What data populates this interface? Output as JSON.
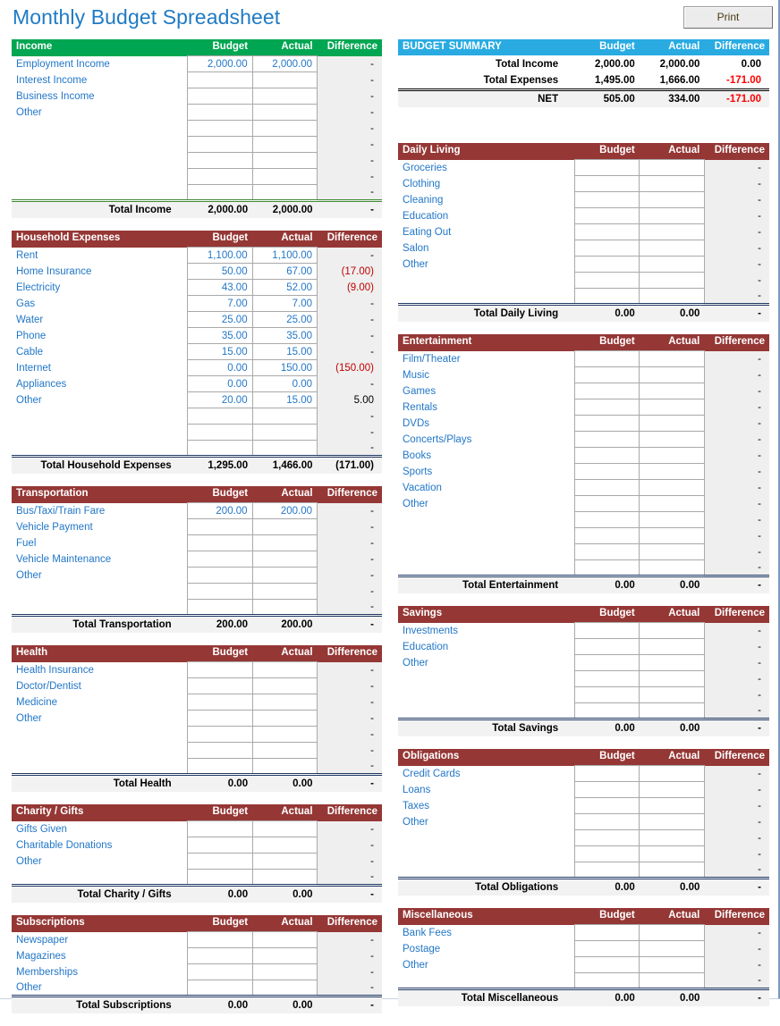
{
  "page": {
    "title": "Monthly Budget Spreadsheet",
    "print_label": "Print"
  },
  "columns": {
    "name_header_default": "",
    "budget": "Budget",
    "actual": "Actual",
    "difference": "Difference"
  },
  "colors": {
    "income_header": "#00a651",
    "expense_header": "#953735",
    "summary_header": "#29abe2",
    "label_blue": "#2277c8",
    "negative_red": "#c00000",
    "title_blue": "#1f7ac4"
  },
  "summary": {
    "header": "BUDGET SUMMARY",
    "budget": "Budget",
    "actual": "Actual",
    "difference": "Difference",
    "rows": [
      {
        "label": "Total Income",
        "budget": "2,000.00",
        "actual": "2,000.00",
        "difference": "0.00",
        "negative": false
      },
      {
        "label": "Total Expenses",
        "budget": "1,495.00",
        "actual": "1,666.00",
        "difference": "-171.00",
        "negative": true
      },
      {
        "label": "NET",
        "budget": "505.00",
        "actual": "334.00",
        "difference": "-171.00",
        "negative": true
      }
    ]
  },
  "sections": {
    "income": {
      "header": "Income",
      "total_label": "Total Income",
      "total_budget": "2,000.00",
      "total_actual": "2,000.00",
      "total_difference": "-",
      "total_negative": false,
      "rows": [
        {
          "label": "Employment Income",
          "budget": "2,000.00",
          "actual": "2,000.00",
          "difference": "-",
          "negative": false
        },
        {
          "label": "Interest Income",
          "budget": "",
          "actual": "",
          "difference": "-",
          "negative": false
        },
        {
          "label": "Business Income",
          "budget": "",
          "actual": "",
          "difference": "-",
          "negative": false
        },
        {
          "label": "Other",
          "budget": "",
          "actual": "",
          "difference": "-",
          "negative": false
        },
        {
          "label": "",
          "budget": "",
          "actual": "",
          "difference": "-",
          "negative": false
        },
        {
          "label": "",
          "budget": "",
          "actual": "",
          "difference": "-",
          "negative": false
        },
        {
          "label": "",
          "budget": "",
          "actual": "",
          "difference": "-",
          "negative": false
        },
        {
          "label": "",
          "budget": "",
          "actual": "",
          "difference": "-",
          "negative": false
        },
        {
          "label": "",
          "budget": "",
          "actual": "",
          "difference": "-",
          "negative": false
        }
      ]
    },
    "household": {
      "header": "Household Expenses",
      "total_label": "Total Household Expenses",
      "total_budget": "1,295.00",
      "total_actual": "1,466.00",
      "total_difference": "(171.00)",
      "total_negative": false,
      "rows": [
        {
          "label": "Rent",
          "budget": "1,100.00",
          "actual": "1,100.00",
          "difference": "-",
          "negative": false
        },
        {
          "label": "Home Insurance",
          "budget": "50.00",
          "actual": "67.00",
          "difference": "(17.00)",
          "negative": true
        },
        {
          "label": "Electricity",
          "budget": "43.00",
          "actual": "52.00",
          "difference": "(9.00)",
          "negative": true
        },
        {
          "label": "Gas",
          "budget": "7.00",
          "actual": "7.00",
          "difference": "-",
          "negative": false
        },
        {
          "label": "Water",
          "budget": "25.00",
          "actual": "25.00",
          "difference": "-",
          "negative": false
        },
        {
          "label": "Phone",
          "budget": "35.00",
          "actual": "35.00",
          "difference": "-",
          "negative": false
        },
        {
          "label": "Cable",
          "budget": "15.00",
          "actual": "15.00",
          "difference": "-",
          "negative": false
        },
        {
          "label": "Internet",
          "budget": "0.00",
          "actual": "150.00",
          "difference": "(150.00)",
          "negative": true
        },
        {
          "label": "Appliances",
          "budget": "0.00",
          "actual": "0.00",
          "difference": "-",
          "negative": false
        },
        {
          "label": "Other",
          "budget": "20.00",
          "actual": "15.00",
          "difference": "5.00",
          "negative": false
        },
        {
          "label": "",
          "budget": "",
          "actual": "",
          "difference": "-",
          "negative": false
        },
        {
          "label": "",
          "budget": "",
          "actual": "",
          "difference": "-",
          "negative": false
        },
        {
          "label": "",
          "budget": "",
          "actual": "",
          "difference": "-",
          "negative": false
        }
      ]
    },
    "transportation": {
      "header": "Transportation",
      "total_label": "Total Transportation",
      "total_budget": "200.00",
      "total_actual": "200.00",
      "total_difference": "-",
      "total_negative": false,
      "rows": [
        {
          "label": "Bus/Taxi/Train Fare",
          "budget": "200.00",
          "actual": "200.00",
          "difference": "-",
          "negative": false
        },
        {
          "label": "Vehicle Payment",
          "budget": "",
          "actual": "",
          "difference": "-",
          "negative": false
        },
        {
          "label": "Fuel",
          "budget": "",
          "actual": "",
          "difference": "-",
          "negative": false
        },
        {
          "label": "Vehicle Maintenance",
          "budget": "",
          "actual": "",
          "difference": "-",
          "negative": false
        },
        {
          "label": "Other",
          "budget": "",
          "actual": "",
          "difference": "-",
          "negative": false
        },
        {
          "label": "",
          "budget": "",
          "actual": "",
          "difference": "-",
          "negative": false
        },
        {
          "label": "",
          "budget": "",
          "actual": "",
          "difference": "-",
          "negative": false
        }
      ]
    },
    "health": {
      "header": "Health",
      "total_label": "Total Health",
      "total_budget": "0.00",
      "total_actual": "0.00",
      "total_difference": "-",
      "total_negative": false,
      "rows": [
        {
          "label": "Health Insurance",
          "budget": "",
          "actual": "",
          "difference": "-",
          "negative": false
        },
        {
          "label": "Doctor/Dentist",
          "budget": "",
          "actual": "",
          "difference": "-",
          "negative": false
        },
        {
          "label": "Medicine",
          "budget": "",
          "actual": "",
          "difference": "-",
          "negative": false
        },
        {
          "label": "Other",
          "budget": "",
          "actual": "",
          "difference": "-",
          "negative": false
        },
        {
          "label": "",
          "budget": "",
          "actual": "",
          "difference": "-",
          "negative": false
        },
        {
          "label": "",
          "budget": "",
          "actual": "",
          "difference": "-",
          "negative": false
        },
        {
          "label": "",
          "budget": "",
          "actual": "",
          "difference": "-",
          "negative": false
        }
      ]
    },
    "charity": {
      "header": "Charity / Gifts",
      "total_label": "Total Charity / Gifts",
      "total_budget": "0.00",
      "total_actual": "0.00",
      "total_difference": "-",
      "total_negative": false,
      "rows": [
        {
          "label": "Gifts Given",
          "budget": "",
          "actual": "",
          "difference": "-",
          "negative": false
        },
        {
          "label": "Charitable Donations",
          "budget": "",
          "actual": "",
          "difference": "-",
          "negative": false
        },
        {
          "label": "Other",
          "budget": "",
          "actual": "",
          "difference": "-",
          "negative": false
        },
        {
          "label": "",
          "budget": "",
          "actual": "",
          "difference": "-",
          "negative": false
        }
      ]
    },
    "subscriptions": {
      "header": "Subscriptions",
      "total_label": "Total Subscriptions",
      "total_budget": "0.00",
      "total_actual": "0.00",
      "total_difference": "-",
      "total_negative": false,
      "rows": [
        {
          "label": "Newspaper",
          "budget": "",
          "actual": "",
          "difference": "-",
          "negative": false
        },
        {
          "label": "Magazines",
          "budget": "",
          "actual": "",
          "difference": "-",
          "negative": false
        },
        {
          "label": "Memberships",
          "budget": "",
          "actual": "",
          "difference": "-",
          "negative": false
        },
        {
          "label": "Other",
          "budget": "",
          "actual": "",
          "difference": "-",
          "negative": false
        }
      ]
    },
    "daily_living": {
      "header": "Daily Living",
      "total_label": "Total Daily Living",
      "total_budget": "0.00",
      "total_actual": "0.00",
      "total_difference": "-",
      "total_negative": false,
      "rows": [
        {
          "label": "Groceries",
          "budget": "",
          "actual": "",
          "difference": "-",
          "negative": false
        },
        {
          "label": "Clothing",
          "budget": "",
          "actual": "",
          "difference": "-",
          "negative": false
        },
        {
          "label": "Cleaning",
          "budget": "",
          "actual": "",
          "difference": "-",
          "negative": false
        },
        {
          "label": "Education",
          "budget": "",
          "actual": "",
          "difference": "-",
          "negative": false
        },
        {
          "label": "Eating Out",
          "budget": "",
          "actual": "",
          "difference": "-",
          "negative": false
        },
        {
          "label": "Salon",
          "budget": "",
          "actual": "",
          "difference": "-",
          "negative": false
        },
        {
          "label": "Other",
          "budget": "",
          "actual": "",
          "difference": "-",
          "negative": false
        },
        {
          "label": "",
          "budget": "",
          "actual": "",
          "difference": "-",
          "negative": false
        },
        {
          "label": "",
          "budget": "",
          "actual": "",
          "difference": "-",
          "negative": false
        }
      ]
    },
    "entertainment": {
      "header": "Entertainment",
      "total_label": "Total Entertainment",
      "total_budget": "0.00",
      "total_actual": "0.00",
      "total_difference": "-",
      "total_negative": false,
      "rows": [
        {
          "label": "Film/Theater",
          "budget": "",
          "actual": "",
          "difference": "-",
          "negative": false
        },
        {
          "label": "Music",
          "budget": "",
          "actual": "",
          "difference": "-",
          "negative": false
        },
        {
          "label": "Games",
          "budget": "",
          "actual": "",
          "difference": "-",
          "negative": false
        },
        {
          "label": "Rentals",
          "budget": "",
          "actual": "",
          "difference": "-",
          "negative": false
        },
        {
          "label": "DVDs",
          "budget": "",
          "actual": "",
          "difference": "-",
          "negative": false
        },
        {
          "label": "Concerts/Plays",
          "budget": "",
          "actual": "",
          "difference": "-",
          "negative": false
        },
        {
          "label": "Books",
          "budget": "",
          "actual": "",
          "difference": "-",
          "negative": false
        },
        {
          "label": "Sports",
          "budget": "",
          "actual": "",
          "difference": "-",
          "negative": false
        },
        {
          "label": "Vacation",
          "budget": "",
          "actual": "",
          "difference": "-",
          "negative": false
        },
        {
          "label": "Other",
          "budget": "",
          "actual": "",
          "difference": "-",
          "negative": false
        },
        {
          "label": "",
          "budget": "",
          "actual": "",
          "difference": "-",
          "negative": false
        },
        {
          "label": "",
          "budget": "",
          "actual": "",
          "difference": "-",
          "negative": false
        },
        {
          "label": "",
          "budget": "",
          "actual": "",
          "difference": "-",
          "negative": false
        },
        {
          "label": "",
          "budget": "",
          "actual": "",
          "difference": "-",
          "negative": false
        }
      ]
    },
    "savings": {
      "header": "Savings",
      "total_label": "Total Savings",
      "total_budget": "0.00",
      "total_actual": "0.00",
      "total_difference": "-",
      "total_negative": false,
      "rows": [
        {
          "label": "Investments",
          "budget": "",
          "actual": "",
          "difference": "-",
          "negative": false
        },
        {
          "label": "Education",
          "budget": "",
          "actual": "",
          "difference": "-",
          "negative": false
        },
        {
          "label": "Other",
          "budget": "",
          "actual": "",
          "difference": "-",
          "negative": false
        },
        {
          "label": "",
          "budget": "",
          "actual": "",
          "difference": "-",
          "negative": false
        },
        {
          "label": "",
          "budget": "",
          "actual": "",
          "difference": "-",
          "negative": false
        },
        {
          "label": "",
          "budget": "",
          "actual": "",
          "difference": "-",
          "negative": false
        }
      ]
    },
    "obligations": {
      "header": "Obligations",
      "total_label": "Total Obligations",
      "total_budget": "0.00",
      "total_actual": "0.00",
      "total_difference": "-",
      "total_negative": false,
      "rows": [
        {
          "label": "Credit Cards",
          "budget": "",
          "actual": "",
          "difference": "-",
          "negative": false
        },
        {
          "label": "Loans",
          "budget": "",
          "actual": "",
          "difference": "-",
          "negative": false
        },
        {
          "label": "Taxes",
          "budget": "",
          "actual": "",
          "difference": "-",
          "negative": false
        },
        {
          "label": "Other",
          "budget": "",
          "actual": "",
          "difference": "-",
          "negative": false
        },
        {
          "label": "",
          "budget": "",
          "actual": "",
          "difference": "-",
          "negative": false
        },
        {
          "label": "",
          "budget": "",
          "actual": "",
          "difference": "-",
          "negative": false
        },
        {
          "label": "",
          "budget": "",
          "actual": "",
          "difference": "-",
          "negative": false
        }
      ]
    },
    "miscellaneous": {
      "header": "Miscellaneous",
      "total_label": "Total Miscellaneous",
      "total_budget": "0.00",
      "total_actual": "0.00",
      "total_difference": "-",
      "total_negative": false,
      "rows": [
        {
          "label": "Bank Fees",
          "budget": "",
          "actual": "",
          "difference": "-",
          "negative": false
        },
        {
          "label": "Postage",
          "budget": "",
          "actual": "",
          "difference": "-",
          "negative": false
        },
        {
          "label": "Other",
          "budget": "",
          "actual": "",
          "difference": "-",
          "negative": false
        },
        {
          "label": "",
          "budget": "",
          "actual": "",
          "difference": "-",
          "negative": false
        }
      ]
    }
  },
  "layout": {
    "left_order": [
      "income",
      "household",
      "transportation",
      "health",
      "charity",
      "subscriptions"
    ],
    "right_order": [
      "daily_living",
      "entertainment",
      "savings",
      "obligations",
      "miscellaneous"
    ]
  }
}
